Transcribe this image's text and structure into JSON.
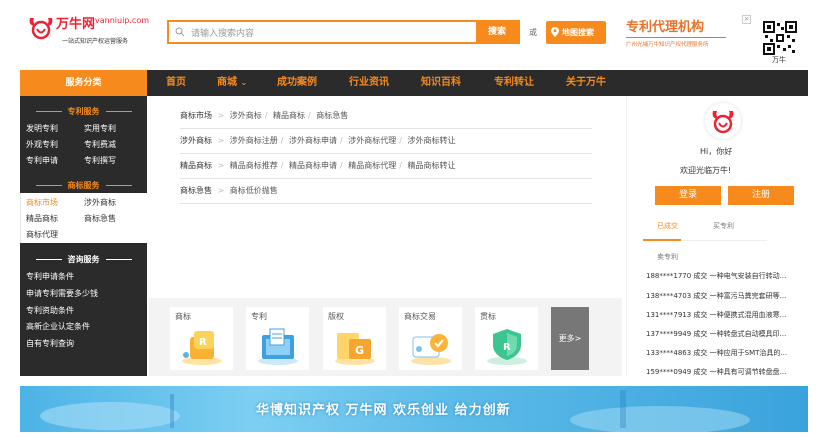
{
  "header": {
    "logo_name": "万牛网",
    "logo_domain": "vanniuip.com",
    "logo_slogan": "一站式知识产权运营服务",
    "search_placeholder": "请输入搜索内容",
    "search_button": "搜索",
    "or_text": "或",
    "map_button": "地图搜索",
    "agency_title": "专利代理机构",
    "agency_sub": "广州光埔万牛知识产权代理服务所",
    "close_label": "×",
    "qr_label": "万牛"
  },
  "nav": {
    "category_label": "服务分类",
    "items": [
      "首页",
      "商城",
      "成功案例",
      "行业资讯",
      "知识百科",
      "专利转让",
      "关于万牛"
    ],
    "dropdown_arrow": "⌄"
  },
  "sidebar": {
    "patent_head": "专利服务",
    "patent_links": [
      "发明专利",
      "实用专利",
      "外观专利",
      "专利费减",
      "专利申请",
      "专利撰写"
    ],
    "trademark_head": "商标服务",
    "trademark_links": [
      "商标市场",
      "涉外商标",
      "精品商标",
      "商标急售",
      "商标代理"
    ],
    "consult_head": "咨询服务",
    "consult_links": [
      "专利申请条件",
      "申请专利需要多少钱",
      "专利资助条件",
      "高新企业认定条件",
      "自有专利查询"
    ]
  },
  "dropdown": {
    "rows": [
      {
        "head": "商标市场",
        "links": [
          "涉外商标",
          "精品商标",
          "商标急售"
        ]
      },
      {
        "head": "涉外商标",
        "links": [
          "涉外商标注册",
          "涉外商标申请",
          "涉外商标代理",
          "涉外商标转让"
        ]
      },
      {
        "head": "精品商标",
        "links": [
          "精品商标推荐",
          "精品商标申请",
          "精品商标代理",
          "精品商标转让"
        ]
      },
      {
        "head": "商标急售",
        "links": [
          "商标低价抛售"
        ]
      }
    ],
    "separator": ">",
    "divider": "/"
  },
  "services": {
    "cards": [
      "商标",
      "专利",
      "版权",
      "商标交易",
      "贯标"
    ],
    "more": "更多>"
  },
  "user_panel": {
    "greeting": "Hi，你好",
    "welcome": "欢迎光临万牛!",
    "login": "登录",
    "register": "注册",
    "tab_done": "已成交",
    "tab_buy": "买专利",
    "sub_label": "卖专利",
    "deals": [
      "188****1770  成交  一种电气安装自行转动...",
      "138****4703  成交  一种富污马粪完套研等...",
      "131****7913  成交  一种便携式混用血液寒...",
      "137****9949  成交  一种转盘式自动模具印...",
      "133****4863  成交  一种应用于SMT治具的...",
      "159****0949  成交  一种具有可调节转盘盘..."
    ]
  },
  "banner": {
    "text": "华博知识产权  万牛网  欢乐创业  给力创新"
  },
  "colors": {
    "accent": "#f68a1d",
    "nav_bg": "#2b2b2b",
    "brand_red": "#e23333"
  }
}
